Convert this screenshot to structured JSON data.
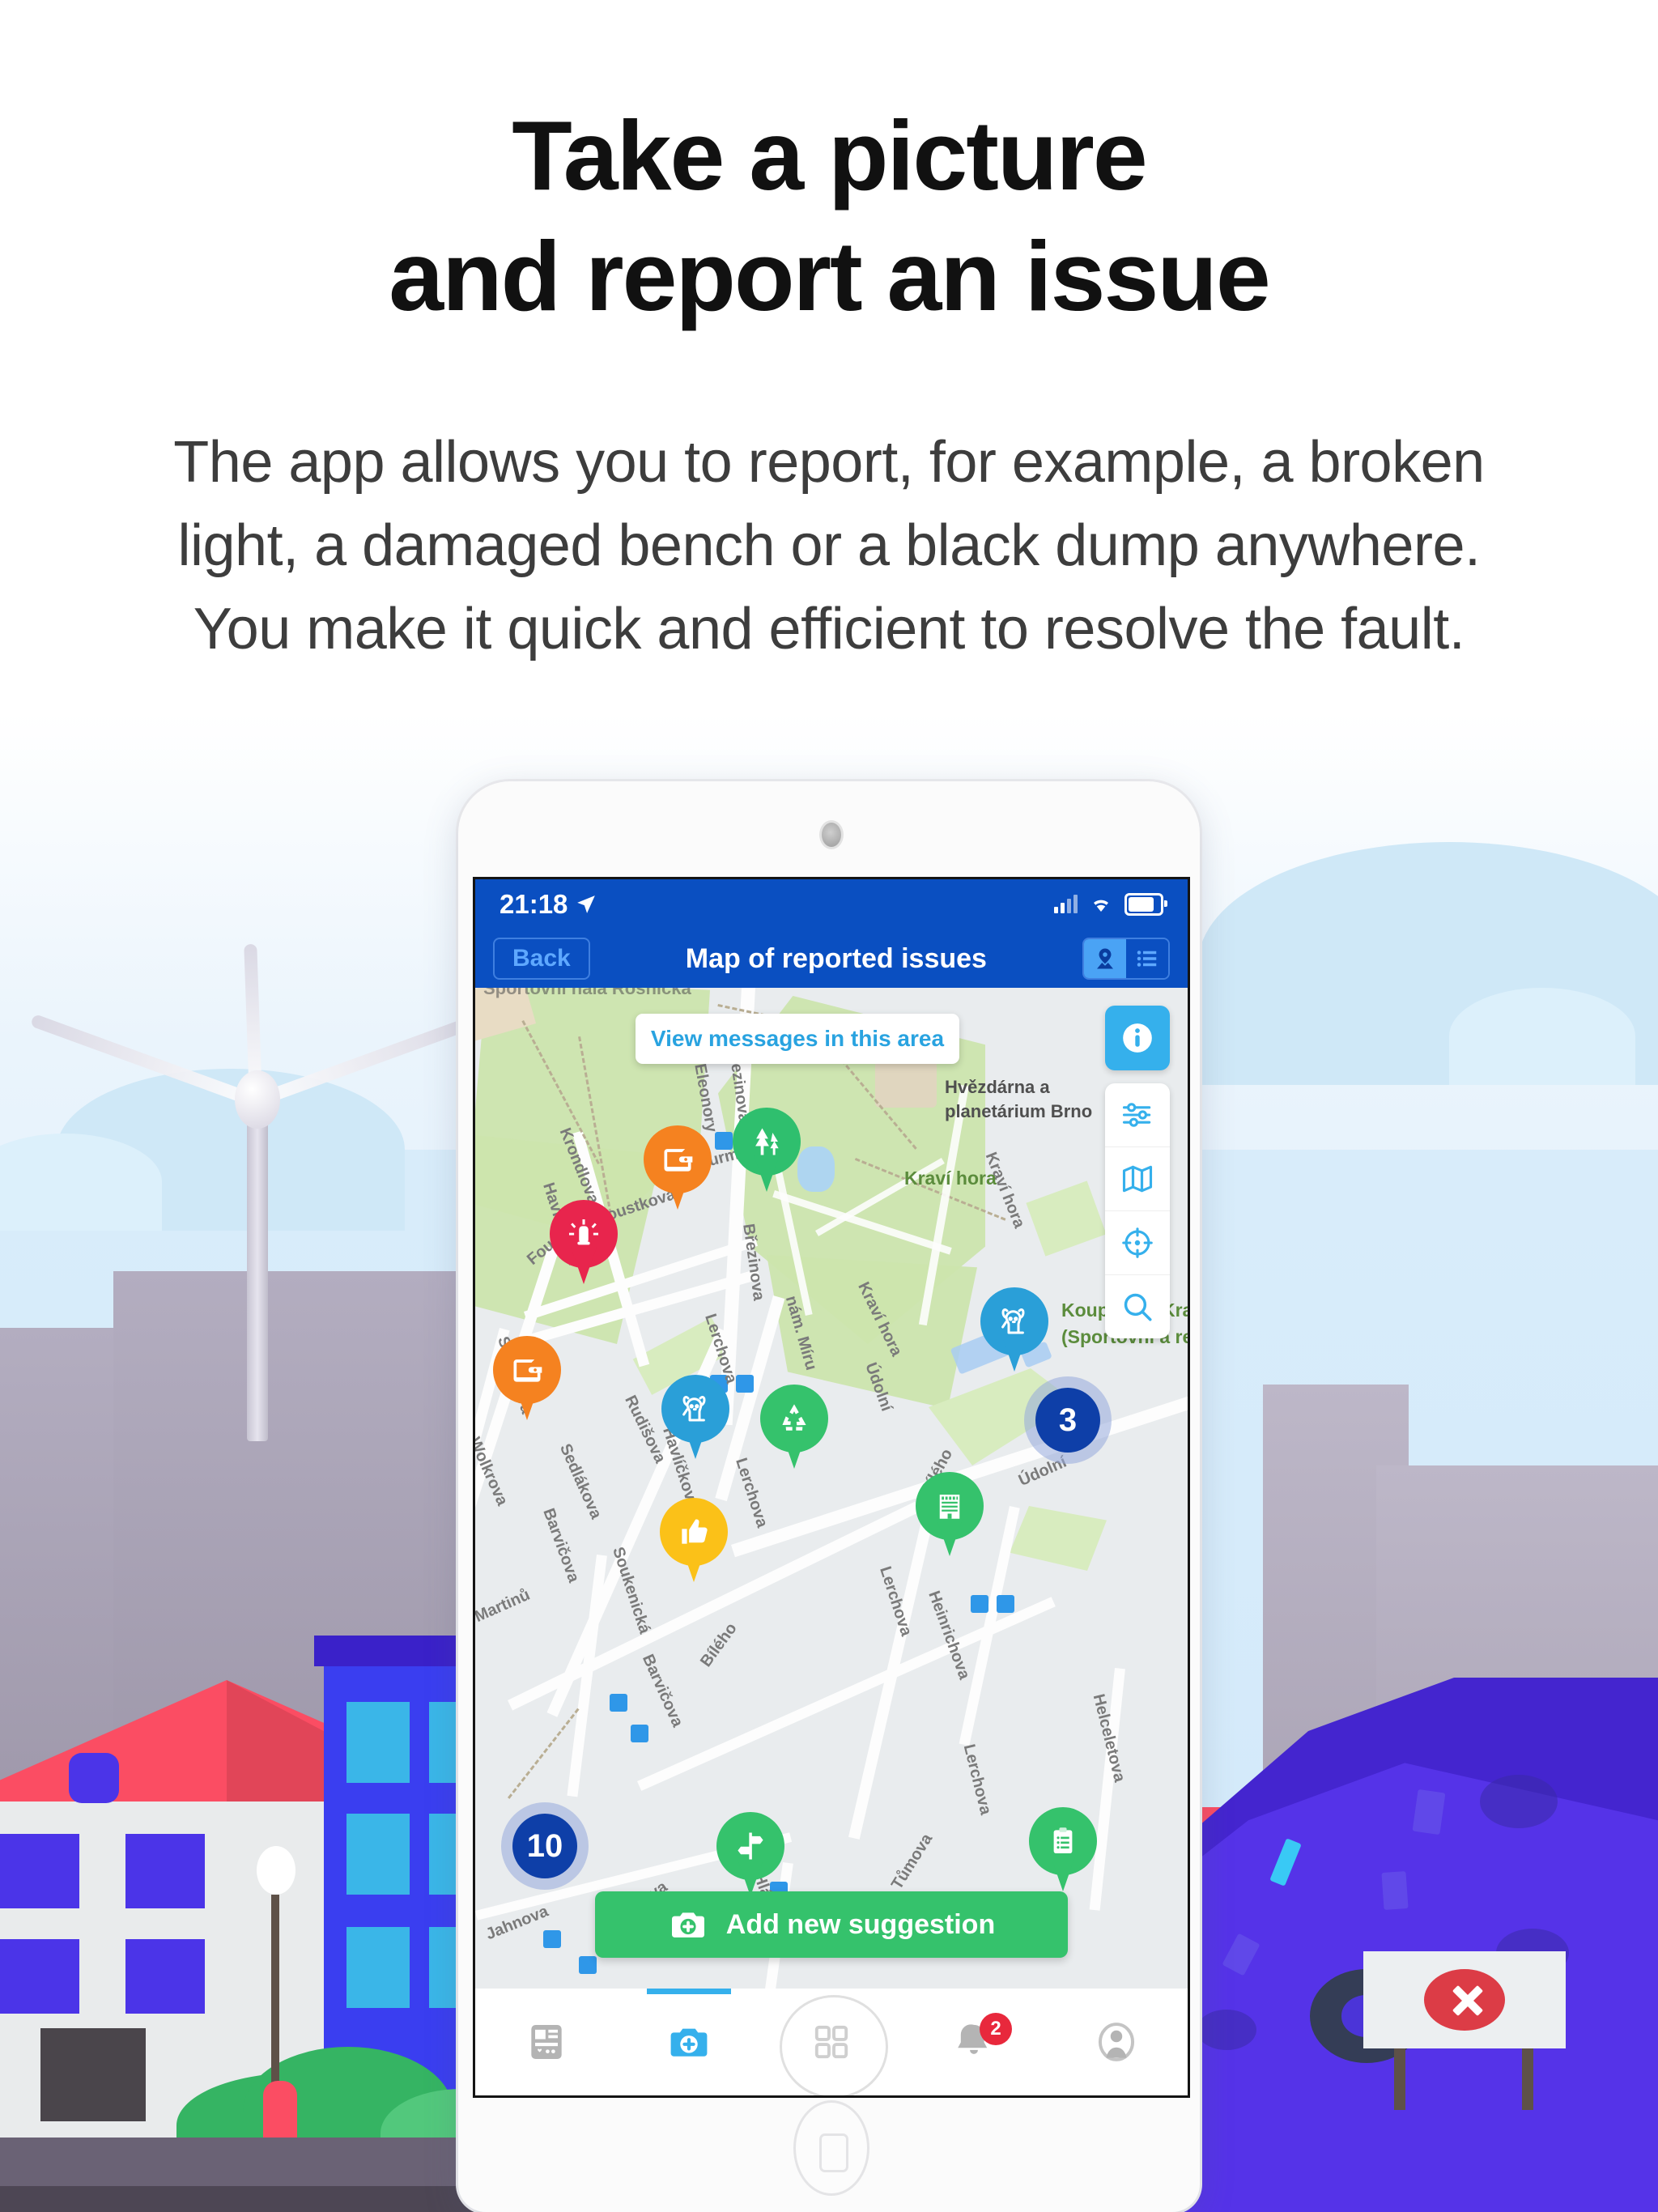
{
  "headline": {
    "line1": "Take a picture",
    "line2": "and report an issue"
  },
  "subcopy": {
    "line1": "The app allows you to report, for example, a broken",
    "line2": "light, a damaged bench or a black dump anywhere.",
    "line3": "You make it quick and efficient to resolve the fault."
  },
  "phone": {
    "status": {
      "time": "21:18",
      "location_icon": "location-arrow-icon",
      "signal_icon": "cellular-bars-icon",
      "wifi_icon": "wifi-icon",
      "battery_icon": "battery-icon"
    },
    "navbar": {
      "back_label": "Back",
      "title": "Map of reported issues",
      "segment_map_icon": "map-pin-icon",
      "segment_list_icon": "list-icon"
    },
    "map": {
      "view_messages_label": "View messages in this area",
      "controls": [
        {
          "name": "info-button",
          "icon": "info-icon",
          "active": true
        },
        {
          "name": "filters-button",
          "icon": "sliders-icon",
          "active": false
        },
        {
          "name": "layers-button",
          "icon": "folded-map-icon",
          "active": false
        },
        {
          "name": "locate-button",
          "icon": "crosshair-icon",
          "active": false
        },
        {
          "name": "search-button",
          "icon": "magnifier-icon",
          "active": false
        }
      ],
      "street_labels": [
        "Krondlova",
        "Foustkova",
        "Foustkova",
        "Eleonory",
        "Březinova",
        "Březinova",
        "Wurmova",
        "Havlíčkova",
        "Sedlákova",
        "Rudišova",
        "Havlíčkova",
        "Lerchova",
        "Lerchova",
        "Lerchova",
        "Lerchova",
        "nám. Míru",
        "Kraví hora",
        "Kraví hora",
        "Údolní",
        "Údolní",
        "Heinrichova",
        "Bílého",
        "Bílého",
        "Barvičova",
        "Barvičova",
        "Wolkrova",
        "Sedlákova",
        "Soukenická",
        "Helceletova",
        "Hlávkova",
        "Jahnova",
        "Preslova",
        "Tůmova",
        "Martinů"
      ],
      "place_labels": [
        {
          "text": "Sportovní hala Rosnička",
          "kind": "poi"
        },
        {
          "text": "Hvězdárna a",
          "kind": "poi"
        },
        {
          "text": "planetárium Brno",
          "kind": "poi"
        },
        {
          "text": "Kraví hora",
          "kind": "park"
        },
        {
          "text": "Koupaliště Kraví h",
          "kind": "park"
        },
        {
          "text": "(Sportovní a rekre",
          "kind": "park"
        }
      ],
      "pins": [
        {
          "name": "pin-wallet-orange-top",
          "icon": "wallet-icon",
          "color": "#f58220"
        },
        {
          "name": "pin-trees-green",
          "icon": "trees-icon",
          "color": "#2fbf6e"
        },
        {
          "name": "pin-alarm-red",
          "icon": "alarm-bell-icon",
          "color": "#e8254d"
        },
        {
          "name": "pin-wallet-orange-left",
          "icon": "wallet-icon",
          "color": "#f58220"
        },
        {
          "name": "pin-dog-blue-left",
          "icon": "dog-icon",
          "color": "#2a9fd8"
        },
        {
          "name": "pin-dog-blue-right",
          "icon": "dog-icon",
          "color": "#2a9fd8"
        },
        {
          "name": "pin-recycle-green",
          "icon": "recycle-icon",
          "color": "#35c26c"
        },
        {
          "name": "pin-thumbsup-yellow",
          "icon": "thumbs-up-icon",
          "color": "#fbc118"
        },
        {
          "name": "pin-building-green",
          "icon": "building-icon",
          "color": "#35c26c"
        },
        {
          "name": "pin-signpost-green",
          "icon": "signpost-icon",
          "color": "#35c26c"
        },
        {
          "name": "pin-clipboard-green",
          "icon": "clipboard-icon",
          "color": "#35c26c"
        }
      ],
      "clusters": [
        {
          "name": "cluster-3",
          "count": "3"
        },
        {
          "name": "cluster-10",
          "count": "10"
        }
      ],
      "add_button": {
        "label": "Add new suggestion",
        "icon": "camera-plus-icon",
        "color": "#35c26c"
      }
    },
    "tabbar": [
      {
        "name": "tab-feed",
        "icon": "news-card-icon",
        "active": false,
        "badge": ""
      },
      {
        "name": "tab-camera",
        "icon": "camera-plus-icon",
        "active": true,
        "badge": ""
      },
      {
        "name": "tab-grid",
        "icon": "grid-icon",
        "active": false,
        "badge": ""
      },
      {
        "name": "tab-notifications",
        "icon": "bell-icon",
        "active": false,
        "badge": "2"
      },
      {
        "name": "tab-profile",
        "icon": "person-icon",
        "active": false,
        "badge": ""
      }
    ]
  },
  "illustration": {
    "no_dumping_sign_icon": "red-x-circle-icon",
    "colors": {
      "sky": "#dfeefb",
      "hill": "#cfe8f7",
      "city": "#9b94a6",
      "roof": "#fb4d63",
      "building_blue": "#3a3ef0",
      "dump_purple": "#5533e8",
      "bush_green": "#35b463",
      "lamp_red": "#fb4d63",
      "ground": "#6a6275"
    }
  },
  "brand": {
    "blue": "#0a4fc1",
    "light_blue": "#35b0ec",
    "green": "#35c26c",
    "red": "#e8283c"
  }
}
